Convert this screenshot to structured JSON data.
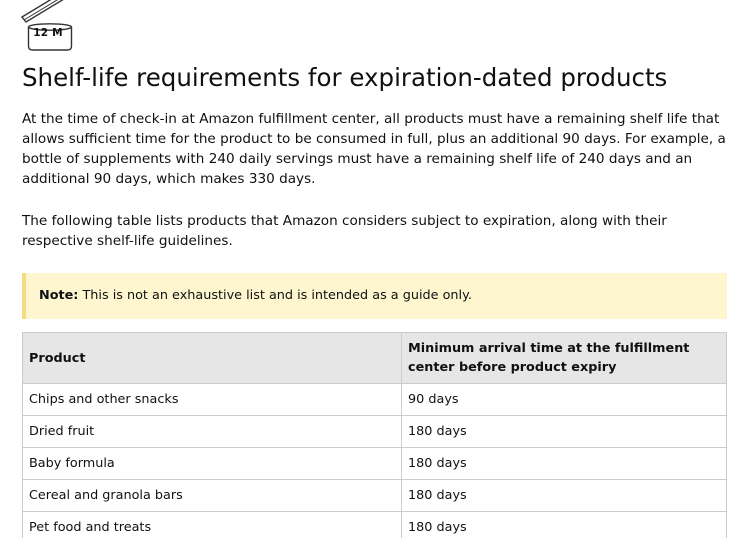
{
  "icon": {
    "name": "open-jar-12m-icon",
    "label": "12 M"
  },
  "heading": "Shelf-life requirements for expiration-dated products",
  "paragraphs": [
    "At the time of check-in at Amazon fulfillment center, all products must have a remaining shelf life that allows sufficient time for the product to be consumed in full, plus an additional 90 days. For example, a bottle of supplements with 240 daily servings must have a remaining shelf life of 240 days and an additional 90 days, which makes 330 days.",
    "The following table lists products that Amazon considers subject to expiration, along with their respective shelf-life guidelines."
  ],
  "note": {
    "label": "Note:",
    "text": " This is not an exhaustive list and is intended as a guide only."
  },
  "table": {
    "headers": [
      "Product",
      "Minimum arrival time at the fulfillment center before product expiry"
    ],
    "rows": [
      [
        "Chips and other snacks",
        "90 days"
      ],
      [
        "Dried fruit",
        "180 days"
      ],
      [
        "Baby formula",
        "180 days"
      ],
      [
        "Cereal and granola bars",
        "180 days"
      ],
      [
        "Pet food and treats",
        "180 days"
      ]
    ]
  }
}
